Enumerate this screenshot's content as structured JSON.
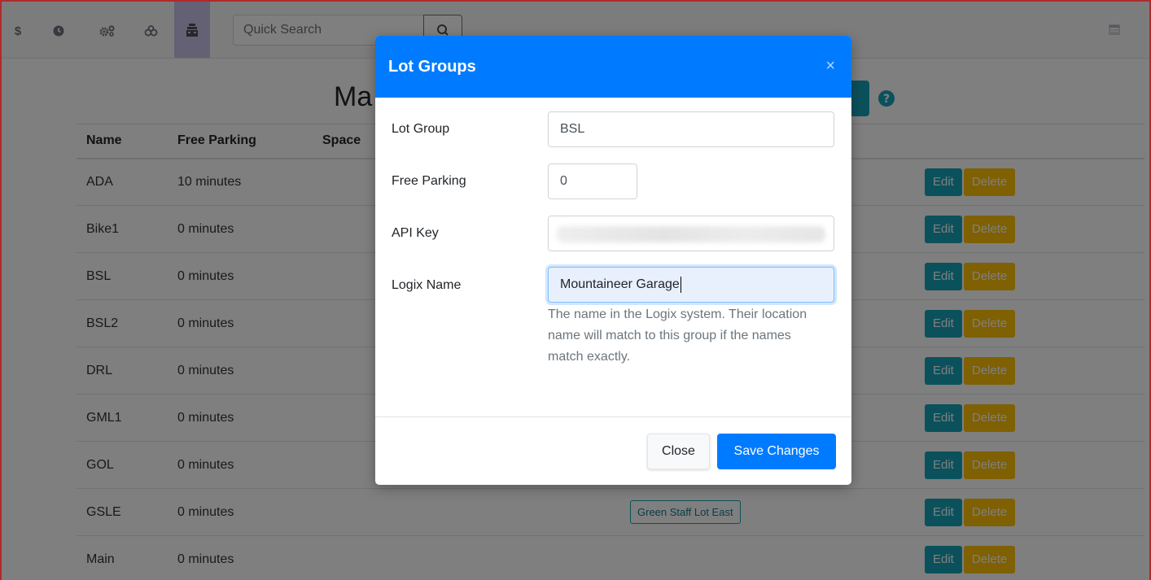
{
  "topbar": {
    "icons": [
      "dollar-icon",
      "clock-icon",
      "gears-icon",
      "cogs-icon",
      "parking-lot-icon",
      "calendar-icon"
    ],
    "dollar_glyph": "$",
    "search_placeholder": "Quick Search"
  },
  "page": {
    "title_fragment": "Ma"
  },
  "table": {
    "headers": [
      "Name",
      "Free Parking",
      "Space"
    ],
    "rows": [
      {
        "name": "ADA",
        "free": "10 minutes",
        "lot": ""
      },
      {
        "name": "Bike1",
        "free": "0 minutes",
        "lot": ""
      },
      {
        "name": "BSL",
        "free": "0 minutes",
        "lot": ""
      },
      {
        "name": "BSL2",
        "free": "0 minutes",
        "lot": ""
      },
      {
        "name": "DRL",
        "free": "0 minutes",
        "lot": ""
      },
      {
        "name": "GML1",
        "free": "0 minutes",
        "lot": ""
      },
      {
        "name": "GOL",
        "free": "0 minutes",
        "lot": ""
      },
      {
        "name": "GSLE",
        "free": "0 minutes",
        "lot": "Green Staff Lot East"
      },
      {
        "name": "Main",
        "free": "0 minutes",
        "lot": ""
      }
    ],
    "edit_label": "Edit",
    "delete_label": "Delete"
  },
  "modal": {
    "title": "Lot Groups",
    "close_glyph": "×",
    "fields": {
      "lot_group": {
        "label": "Lot Group",
        "value": "BSL"
      },
      "free_parking": {
        "label": "Free Parking",
        "value": "0"
      },
      "api_key": {
        "label": "API Key",
        "value": ""
      },
      "logix_name": {
        "label": "Logix Name",
        "value": "Mountaineer Garage"
      }
    },
    "help_text": "The name in the Logix system. Their location name will match to this group if the names match exactly.",
    "close_button": "Close",
    "save_button": "Save Changes"
  },
  "colors": {
    "primary": "#007bff",
    "info": "#17a2b8",
    "warning": "#ffc107",
    "frame": "#b02a2a",
    "nav_active": "#c9c3ea"
  }
}
